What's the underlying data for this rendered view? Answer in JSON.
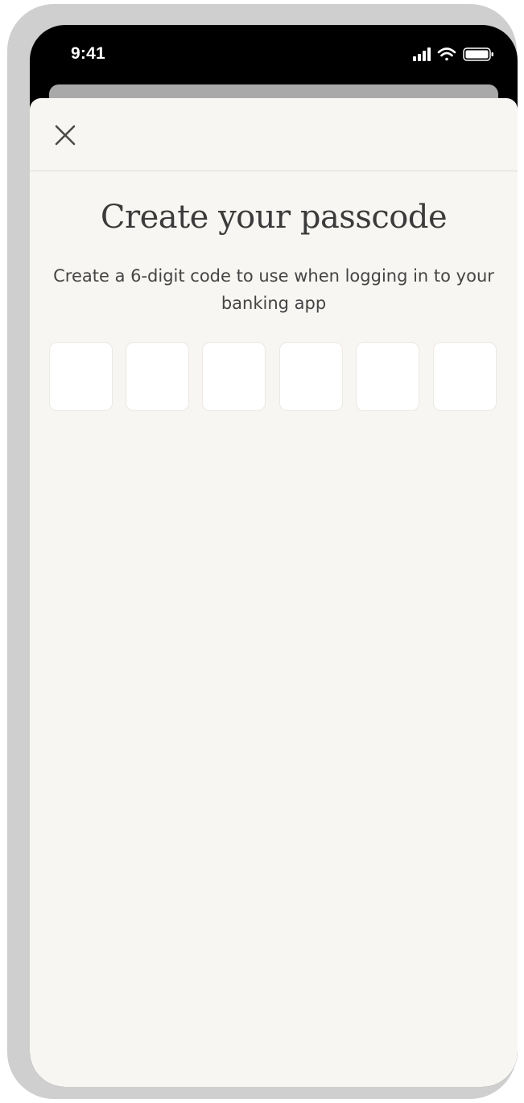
{
  "status_bar": {
    "time": "9:41",
    "icons": [
      "signal-icon",
      "wifi-icon",
      "battery-icon"
    ]
  },
  "sheet": {
    "close_icon": "close-icon",
    "title": "Create your passcode",
    "subtitle": "Create a 6-digit code to use when logging in to your banking app",
    "code_digits": [
      "",
      "",
      "",
      "",
      "",
      ""
    ]
  },
  "colors": {
    "sheet_background": "#f7f6f3",
    "text_primary": "#3b3b3b",
    "code_box": "#ffffff",
    "device_frame": "#cfcfcf"
  }
}
